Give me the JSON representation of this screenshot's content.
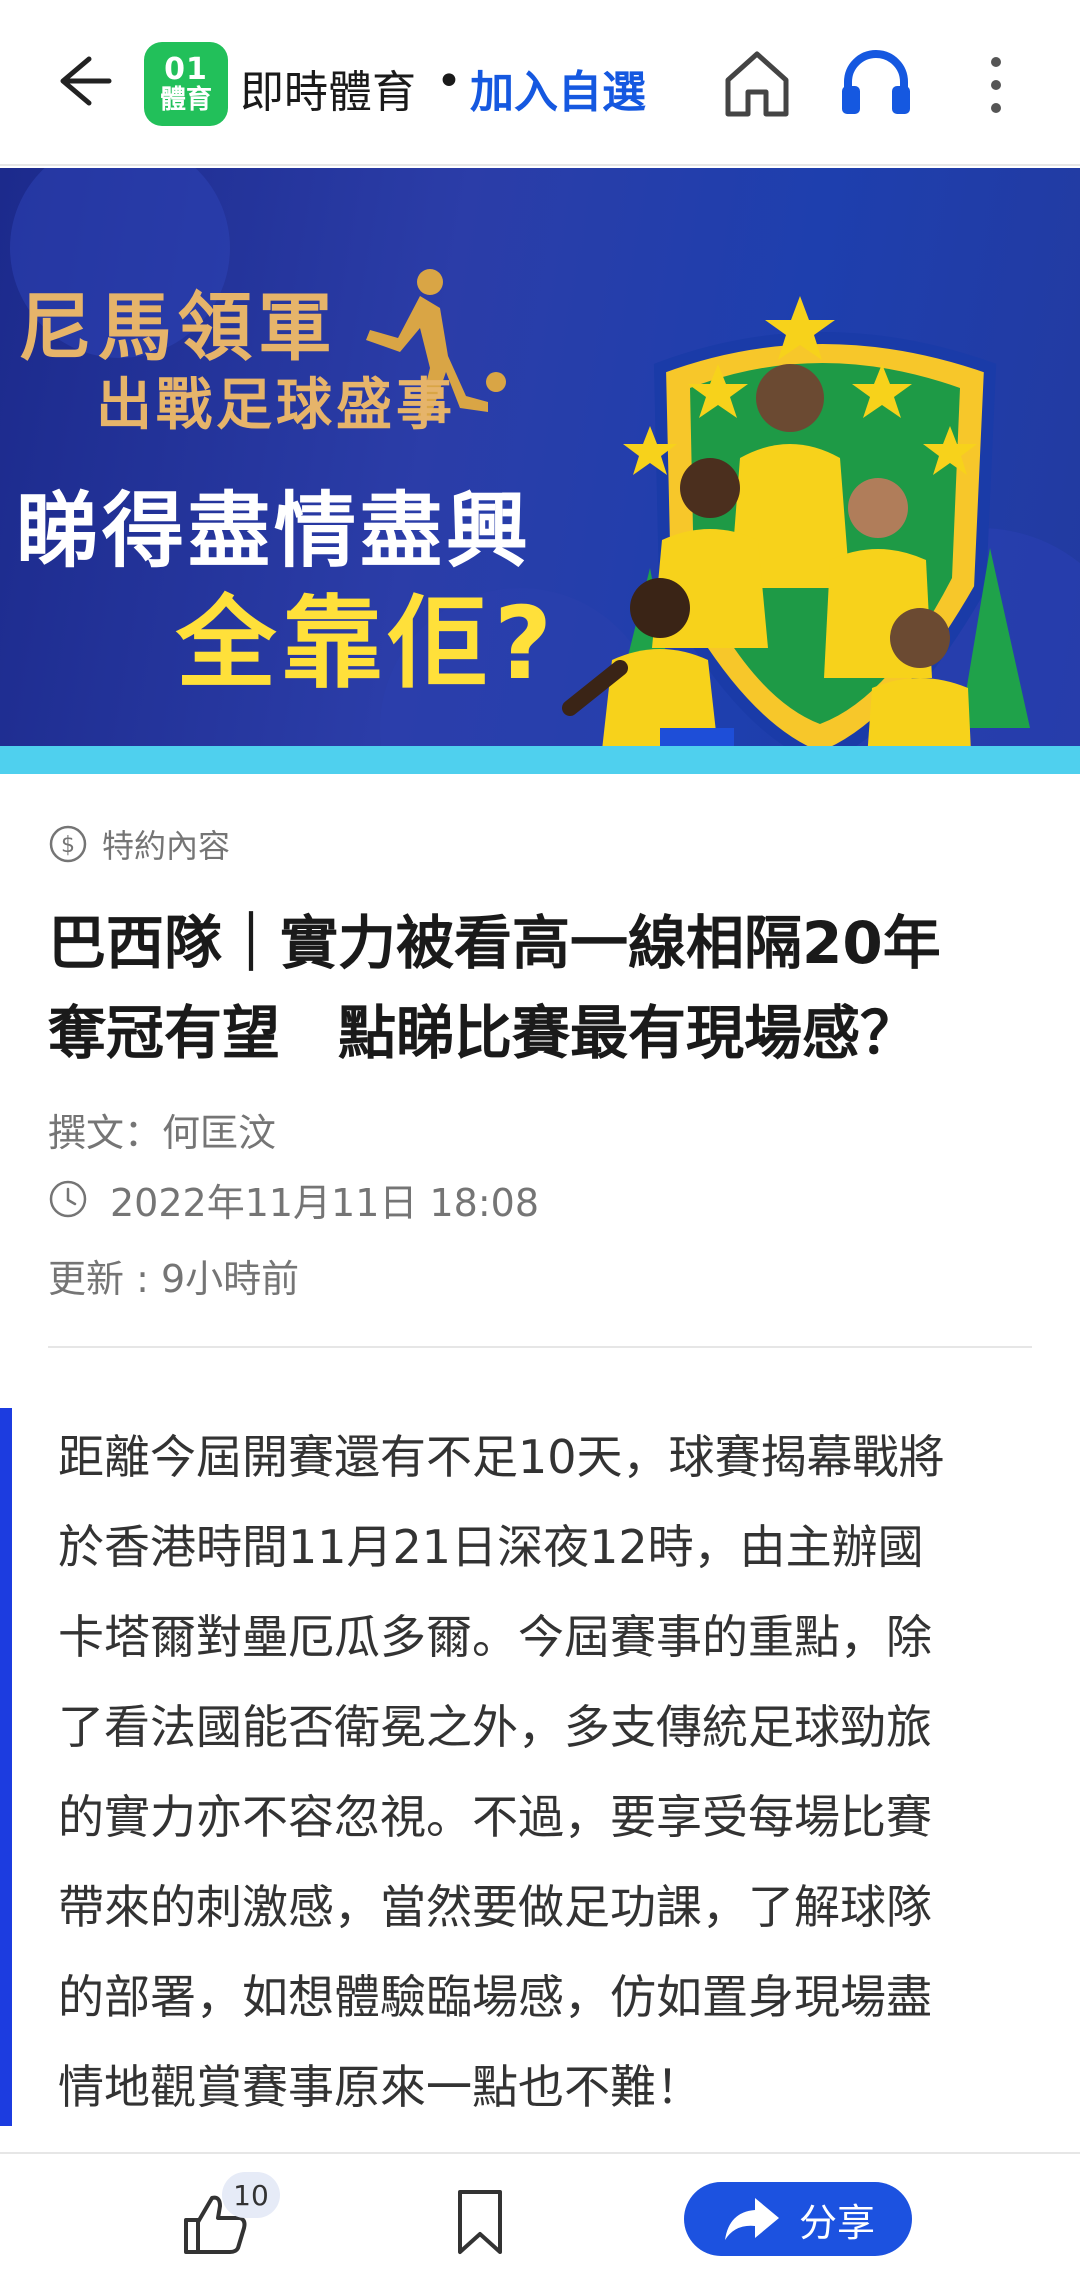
{
  "header": {
    "logo_line1": "01",
    "logo_line2": "體育",
    "channel_name": "即時體育",
    "separator": "•",
    "follow_label": "加入自選",
    "icons": {
      "back": "arrow-left-icon",
      "home": "home-icon",
      "listen": "headphones-icon",
      "more": "more-vertical-icon"
    }
  },
  "banner": {
    "line1": "尼馬領軍",
    "line2": "出戰足球盛事",
    "line3": "睇得盡情盡興",
    "line4": "全靠佢?",
    "colors": {
      "background": "#233aa0",
      "strip": "#4fd0ee",
      "gold": "#e6b46a",
      "yellow": "#ffe03a",
      "jersey": "#f7d21b"
    }
  },
  "article": {
    "sponsor_label": "特約內容",
    "headline": [
      "巴西隊｜實力被看高一線相隔20年",
      "奪冠有望　點睇比賽最有現場感？"
    ],
    "byline": "撰文：何匡汶",
    "date": "2022年11月11日 18:08",
    "updated": "更新 : 9小時前",
    "lead": [
      "距離今屆開賽還有不足10天，球賽揭幕戰將",
      "於香港時間11月21日深夜12時，由主辦國",
      "卡塔爾對壘厄瓜多爾。今屆賽事的重點，除",
      "了看法國能否衛冕之外，多支傳統足球勁旅",
      "的實力亦不容忽視。不過，要享受每場比賽",
      "帶來的刺激感，當然要做足功課，了解球隊",
      "的部署，如想體驗臨場感，仿如置身現場盡",
      "情地觀賞賽事原來一點也不難！"
    ]
  },
  "toolbar": {
    "like_count": "10",
    "share_label": "分享",
    "icons": {
      "like": "thumbs-up-icon",
      "bookmark": "bookmark-icon",
      "share": "share-arrow-icon"
    }
  },
  "colors": {
    "accent": "#1558e0",
    "brand_green": "#22c05a",
    "quote_bar": "#1c3ce0",
    "muted_text": "#757575"
  }
}
